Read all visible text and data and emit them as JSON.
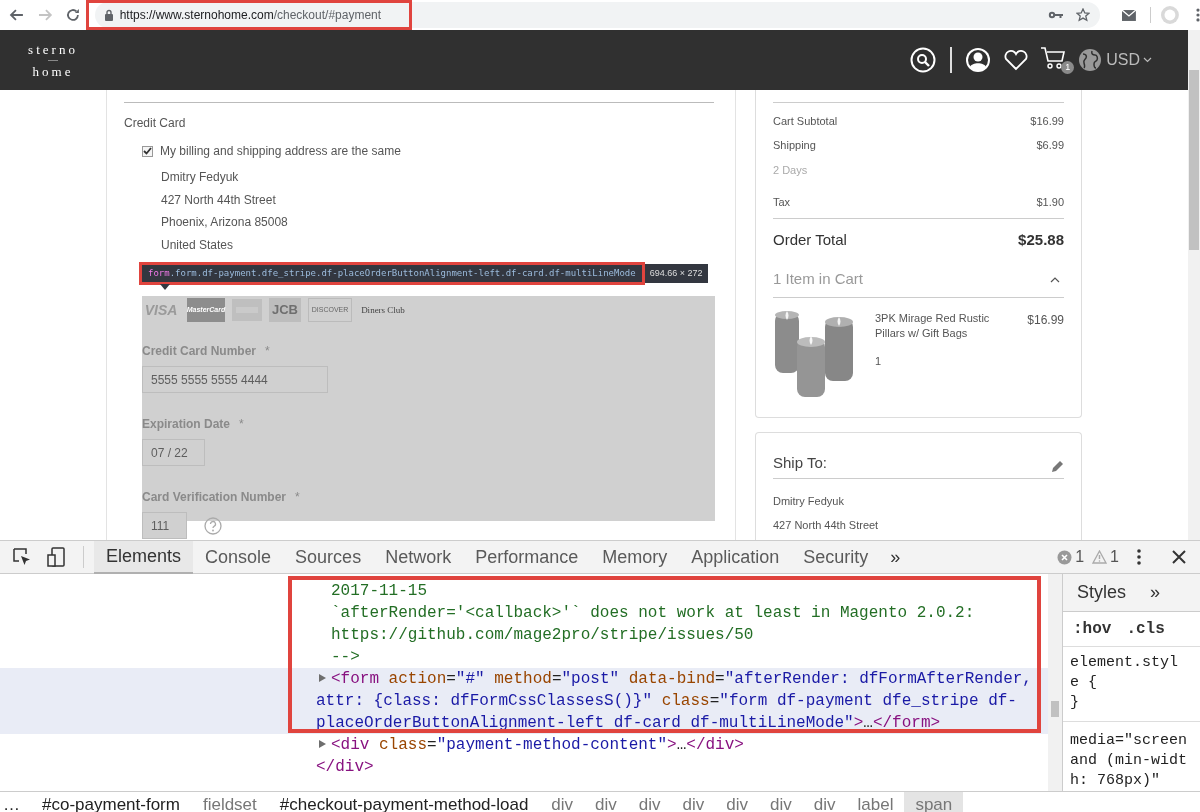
{
  "browser": {
    "back_enabled": true,
    "forward_enabled": false,
    "url_host": "https://www.sternohome.com",
    "url_path": "/checkout/#payment"
  },
  "header": {
    "logo_top": "sterno",
    "logo_bottom": "home",
    "cart_count": "1",
    "currency": "USD"
  },
  "payment": {
    "method": "Credit Card",
    "same_address": {
      "label": "My billing and shipping address are the same",
      "checked": true
    },
    "address": [
      "Dmitry Fedyuk",
      "427 North 44th Street",
      "Phoenix, Arizona 85008",
      "United States"
    ],
    "inspector_tooltip": {
      "tag": "form",
      "classes": ".form.df-payment.dfe_stripe.df-placeOrderButtonAlignment-left.df-card.df-multiLineMode",
      "size": "694.66 × 272"
    },
    "card_logos": [
      {
        "kind": "plain",
        "label": "VISA"
      },
      {
        "kind": "dark",
        "label": "MasterCard"
      },
      {
        "kind": "blank"
      },
      {
        "kind": "block",
        "label": "JCB"
      },
      {
        "kind": "outline",
        "label": "DISCOVER"
      },
      {
        "kind": "plain",
        "label": "Diners Club"
      }
    ],
    "fields": [
      {
        "label": "Credit Card Number",
        "required": "*",
        "value": "5555 5555 5555 4444",
        "help": false
      },
      {
        "label": "Expiration Date",
        "required": "*",
        "value": "07 / 22",
        "help": false
      },
      {
        "label": "Card Verification Number",
        "required": "*",
        "value": "111",
        "help": true
      }
    ]
  },
  "summary": {
    "rows": [
      {
        "kind": "line",
        "label": "Cart Subtotal",
        "value": "$16.99"
      },
      {
        "kind": "line",
        "label": "Shipping",
        "value": "$6.99"
      },
      {
        "kind": "note",
        "label": "2 Days"
      },
      {
        "kind": "line",
        "label": "Tax",
        "value": "$1.90"
      }
    ],
    "total": {
      "label": "Order Total",
      "value": "$25.88"
    },
    "cart": {
      "label": "1 Item in Cart",
      "expanded": true
    },
    "items": [
      {
        "name": "3PK Mirage Red Rustic Pillars w/ Gift Bags",
        "price": "$16.99",
        "qty": "1"
      }
    ]
  },
  "ship_to": {
    "title": "Ship To:",
    "lines": [
      "Dmitry Fedyuk",
      "427 North 44th Street"
    ]
  },
  "devtools": {
    "tabs": [
      {
        "label": "Elements",
        "selected": true
      },
      {
        "label": "Console",
        "selected": false
      },
      {
        "label": "Sources",
        "selected": false
      },
      {
        "label": "Network",
        "selected": false
      },
      {
        "label": "Performance",
        "selected": false
      },
      {
        "label": "Memory",
        "selected": false
      },
      {
        "label": "Application",
        "selected": false
      },
      {
        "label": "Security",
        "selected": false
      }
    ],
    "more": "»",
    "errors": "1",
    "warnings": "1",
    "lines": [
      {
        "kind": "comment",
        "segments": [
          {
            "kind": "comment",
            "text": "2017-11-15"
          }
        ]
      },
      {
        "kind": "comment",
        "segments": [
          {
            "kind": "comment",
            "text": "`afterRender='<callback>'` does not work at least in Magento 2.0.2:"
          }
        ]
      },
      {
        "kind": "comment",
        "segments": [
          {
            "kind": "comment",
            "text": "https://github.com/mage2pro/stripe/issues/50"
          }
        ]
      },
      {
        "kind": "comment",
        "segments": [
          {
            "kind": "comment",
            "text": "-->"
          }
        ]
      },
      {
        "kind": "node",
        "selected": true,
        "segments": [
          {
            "kind": "tag",
            "text": "<form"
          },
          {
            "kind": "attr",
            "text": " action"
          },
          {
            "kind": "punct",
            "text": "="
          },
          {
            "kind": "value",
            "text": "\"#\""
          },
          {
            "kind": "attr",
            "text": " method"
          },
          {
            "kind": "punct",
            "text": "="
          },
          {
            "kind": "value",
            "text": "\"post\""
          },
          {
            "kind": "attr",
            "text": " data-bind"
          },
          {
            "kind": "punct",
            "text": "="
          },
          {
            "kind": "value",
            "text": "\"afterRender: dfFormAfterRender, attr: {class: dfFormCssClassesS()}\""
          },
          {
            "kind": "attr",
            "text": " class"
          },
          {
            "kind": "punct",
            "text": "="
          },
          {
            "kind": "value",
            "text": "\"form df-payment dfe_stripe df-placeOrderButtonAlignment-left df-card df-multiLineMode\""
          },
          {
            "kind": "tag",
            "text": ">"
          },
          {
            "kind": "punct",
            "text": "…"
          },
          {
            "kind": "tag",
            "text": "</form>"
          }
        ]
      },
      {
        "kind": "node",
        "selected": false,
        "segments": [
          {
            "kind": "tag",
            "text": "<div"
          },
          {
            "kind": "attr",
            "text": " class"
          },
          {
            "kind": "punct",
            "text": "="
          },
          {
            "kind": "value",
            "text": "\"payment-method-content\""
          },
          {
            "kind": "tag",
            "text": ">"
          },
          {
            "kind": "punct",
            "text": "…"
          },
          {
            "kind": "tag",
            "text": "</div>"
          }
        ]
      },
      {
        "kind": "close",
        "segments": [
          {
            "kind": "tag",
            "text": "</div>"
          }
        ]
      }
    ],
    "breadcrumbs": [
      {
        "kind": "more",
        "label": "…",
        "selected": false
      },
      {
        "kind": "id",
        "label": "#co-payment-form",
        "selected": false
      },
      {
        "kind": "tag",
        "label": "fieldset",
        "selected": false
      },
      {
        "kind": "id",
        "label": "#checkout-payment-method-load",
        "selected": false
      },
      {
        "kind": "tag",
        "label": "div",
        "selected": false
      },
      {
        "kind": "tag",
        "label": "div",
        "selected": false
      },
      {
        "kind": "tag",
        "label": "div",
        "selected": false
      },
      {
        "kind": "tag",
        "label": "div",
        "selected": false
      },
      {
        "kind": "tag",
        "label": "div",
        "selected": false
      },
      {
        "kind": "tag",
        "label": "div",
        "selected": false
      },
      {
        "kind": "tag",
        "label": "div",
        "selected": false
      },
      {
        "kind": "tag",
        "label": "label",
        "selected": false
      },
      {
        "kind": "tag",
        "label": "span",
        "selected": true
      }
    ],
    "styles": {
      "tab": "Styles",
      "more": "»",
      "hov": ":hov",
      "cls": ".cls",
      "rules": [
        "element.style {",
        "}"
      ],
      "media": "media=\"screen and (min-width: 768px)\""
    }
  }
}
